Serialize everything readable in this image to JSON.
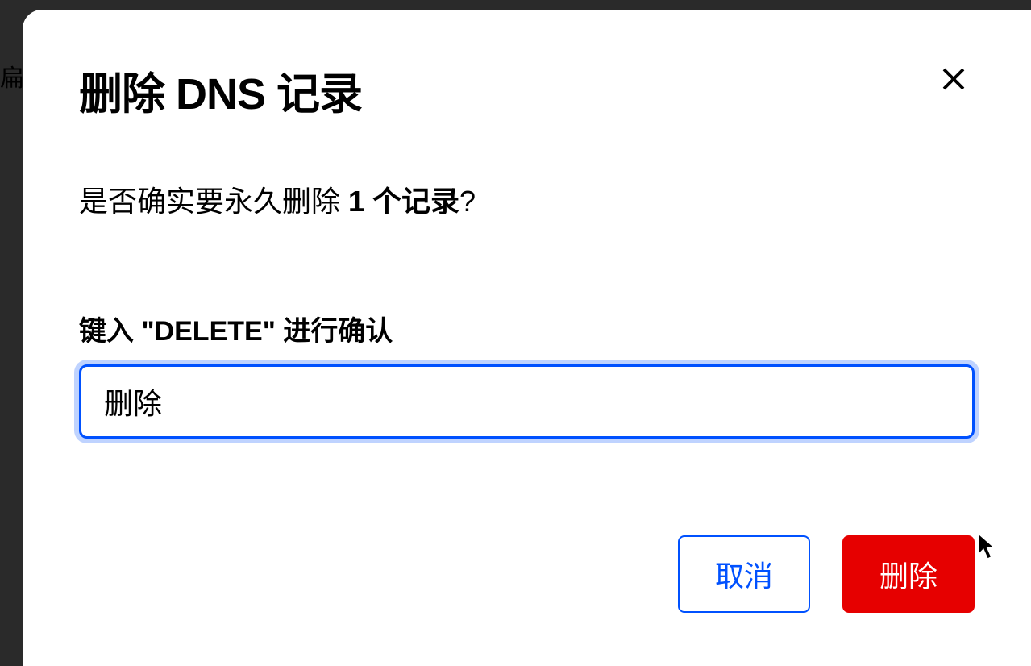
{
  "modal": {
    "title": "删除 DNS 记录",
    "confirm_prefix": "是否确实要永久删除 ",
    "confirm_count": "1 个记录",
    "confirm_suffix": "?",
    "input_label": "键入 \"DELETE\" 进行确认",
    "input_value": "删除",
    "cancel_label": "取消",
    "delete_label": "删除"
  },
  "background": {
    "partial_text": "扁"
  }
}
